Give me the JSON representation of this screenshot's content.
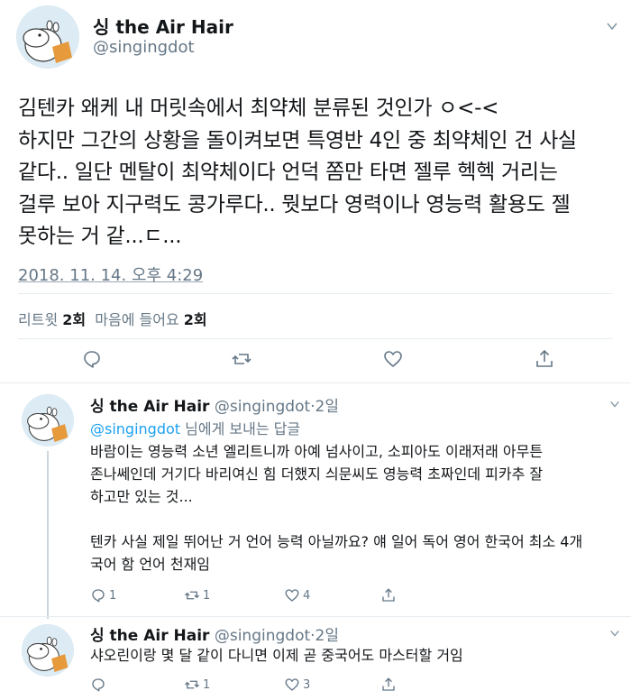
{
  "tweet": {
    "name": "싱 the Air Hair",
    "handle": "@singingdot",
    "lines": [
      "김텐카 왜케 내 머릿속에서 최약체 분류된 것인가 ㅇ<-<",
      "하지만 그간의 상황을 돌이켜보면 특영반 4인 중 최약체인 건 사실",
      "같다.. 일단 멘탈이 최약체이다 언덕 쫌만 타면 젤루 헥헥 거리는",
      "걸루 보아 지구력도 콩가루다.. 뭣보다 영력이나 영능력 활용도 젤",
      "못하는 거 같...ㄷ..."
    ],
    "timestamp": "2018. 11. 14. 오후 4:29",
    "retweets_label": "리트윗",
    "retweets_count": "2회",
    "likes_label": "마음에 들어요",
    "likes_count": "2회",
    "actions": [
      "reply-icon",
      "retweet-icon",
      "like-icon",
      "share-icon"
    ]
  },
  "replies": [
    {
      "name": "싱 the Air Hair",
      "handle": "@singingdot",
      "age": "2일",
      "replying_to": {
        "mention": "@singingdot",
        "suffix": " 님에게 보내는 답글"
      },
      "text": "바람이는 영능력 소년 엘리트니까 아예 넘사이고, 소피아도 이래저래 아무튼\n존나쎄인데 거기다 바리여신 힘 더했지 싀문씨도 영능력 초짜인데 피카추 잘\n하고만 있는 것...\n\n텐카 사실 제일 뛰어난 거 언어 능력 아닐까요? 얘 일어 독어 영어 한국어 최소 4개\n국어 함 언어 천재임",
      "replies": "1",
      "retweets": "1",
      "likes": "4"
    },
    {
      "name": "싱 the Air Hair",
      "handle": "@singingdot",
      "age": "2일",
      "text": "샤오린이랑 몇 달 같이 다니면 이제 곧 중국어도 마스터할 거임",
      "replies": "",
      "retweets": "1",
      "likes": "3"
    }
  ],
  "colors": {
    "text": "#14171a",
    "secondary": "#657786",
    "link": "#1da1f2",
    "border": "#e6ecf0",
    "avatar_bg": "#d9eaf3"
  }
}
